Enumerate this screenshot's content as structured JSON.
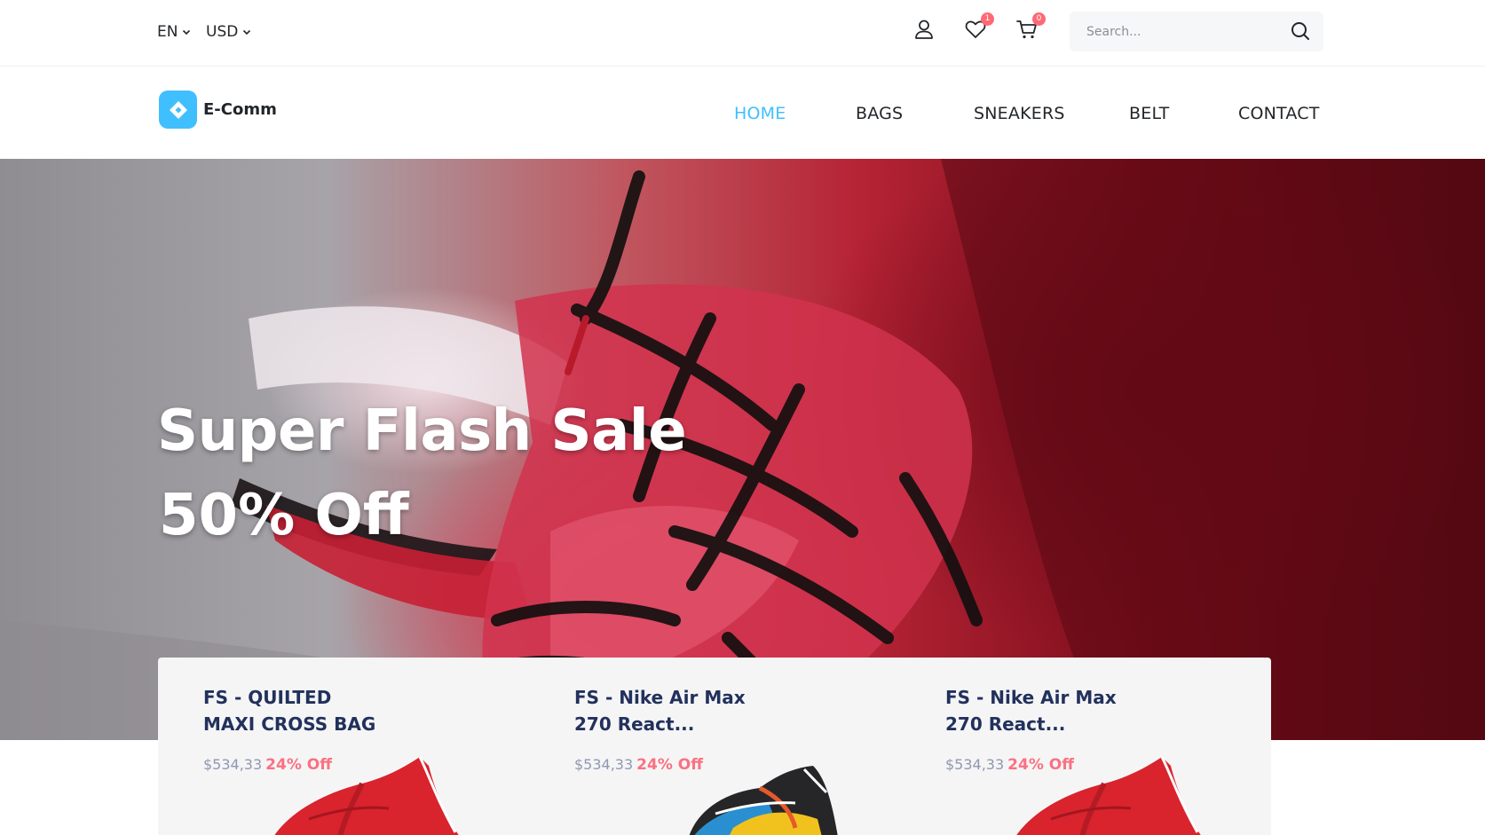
{
  "topbar": {
    "language": "EN",
    "currency": "USD",
    "wishlist_count": "1",
    "cart_count": "0",
    "search_placeholder": "Search..."
  },
  "brand": {
    "name": "E-Comm",
    "accent": "#40bfff"
  },
  "nav": {
    "items": [
      {
        "label": "HOME",
        "active": true
      },
      {
        "label": "BAGS",
        "active": false
      },
      {
        "label": "SNEAKERS",
        "active": false
      },
      {
        "label": "BELT",
        "active": false
      },
      {
        "label": "CONTACT",
        "active": false
      }
    ]
  },
  "hero": {
    "title": "Super Flash Sale",
    "subtitle": "50% Off"
  },
  "flash_sale": {
    "items": [
      {
        "name_line1": "FS - QUILTED",
        "name_line2": "MAXI CROSS BAG",
        "price": "$534,33",
        "discount": "24% Off",
        "image": "red-sneaker"
      },
      {
        "name_line1": "FS - Nike Air Max",
        "name_line2": "270 React...",
        "price": "$534,33",
        "discount": "24% Off",
        "image": "multicolor-sneaker"
      },
      {
        "name_line1": "FS - Nike Air Max",
        "name_line2": "270 React...",
        "price": "$534,33",
        "discount": "24% Off",
        "image": "red-sneaker"
      }
    ]
  },
  "colors": {
    "discount": "#fb7181",
    "title_navy": "#22315c",
    "price_gray": "#9098b1",
    "badge": "#ff6875"
  }
}
